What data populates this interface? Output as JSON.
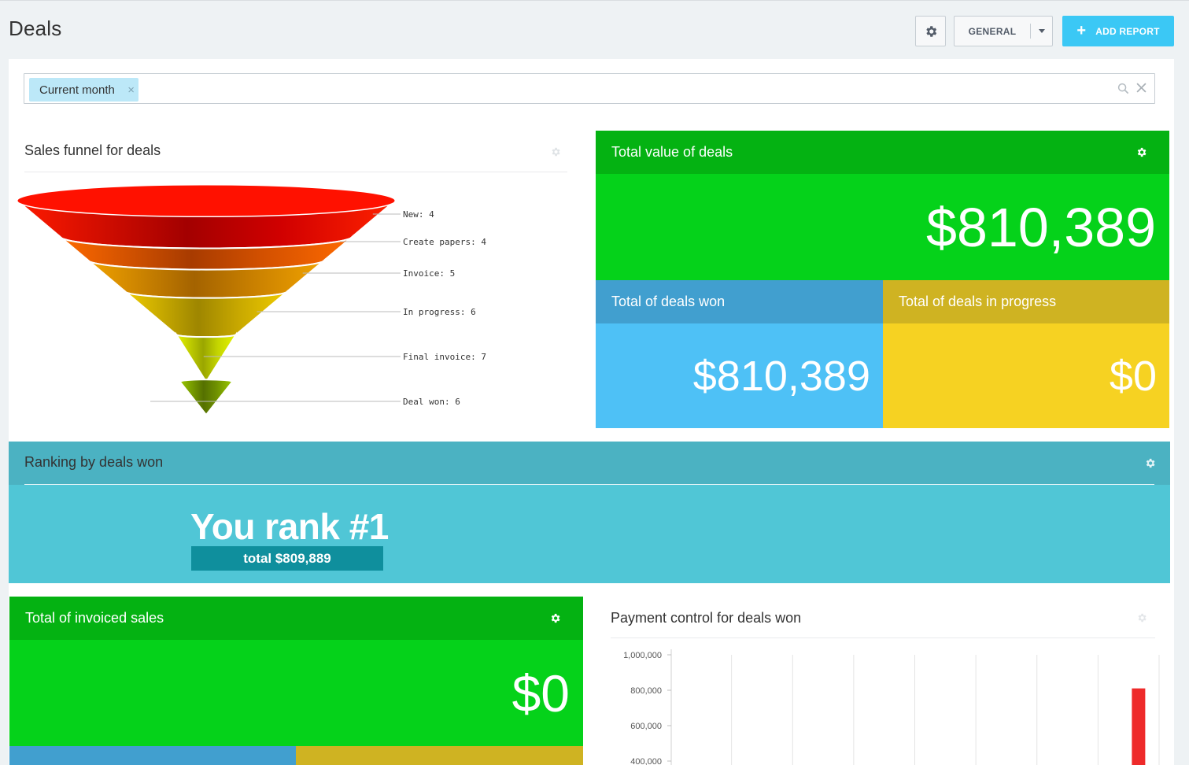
{
  "header": {
    "title": "Deals",
    "general_label": "GENERAL",
    "add_report_label": "ADD REPORT"
  },
  "filter": {
    "chip_label": "Current month"
  },
  "funnel": {
    "title": "Sales funnel for deals",
    "stages": [
      {
        "label": "New: 4",
        "color": "#ff1100"
      },
      {
        "label": "Create papers: 4",
        "color": "#f25a00"
      },
      {
        "label": "Invoice: 5",
        "color": "#e58f00"
      },
      {
        "label": "In progress: 6",
        "color": "#e5c300"
      },
      {
        "label": "Final invoice: 7",
        "color": "#dcec00"
      },
      {
        "label": "Deal won: 6",
        "color": "#7fa800"
      }
    ]
  },
  "total_value": {
    "title": "Total value of deals",
    "value": "$810,389"
  },
  "deals_won": {
    "title": "Total of deals won",
    "value": "$810,389"
  },
  "deals_in_progress": {
    "title": "Total of deals in progress",
    "value": "$0"
  },
  "ranking": {
    "title": "Ranking by deals won",
    "headline": "You rank #1",
    "total": "total $809,889"
  },
  "invoiced": {
    "title": "Total of invoiced sales",
    "value": "$0"
  },
  "payment": {
    "title": "Payment control for deals won"
  },
  "chart_data": {
    "type": "bar",
    "yticks": [
      "1,000,000",
      "800,000",
      "600,000",
      "400,000"
    ],
    "ylim": [
      400000,
      1000000
    ],
    "columns": 8,
    "bars": [
      {
        "column": 7,
        "value": 810389,
        "color": "#ee2a2a"
      }
    ]
  },
  "colors": {
    "accent_blue": "#3bc8f5",
    "green_dark": "#04b212",
    "green": "#05d21a",
    "blue": "#4ec1f6",
    "yellow": "#f6d222",
    "teal": "#50c6d6"
  }
}
